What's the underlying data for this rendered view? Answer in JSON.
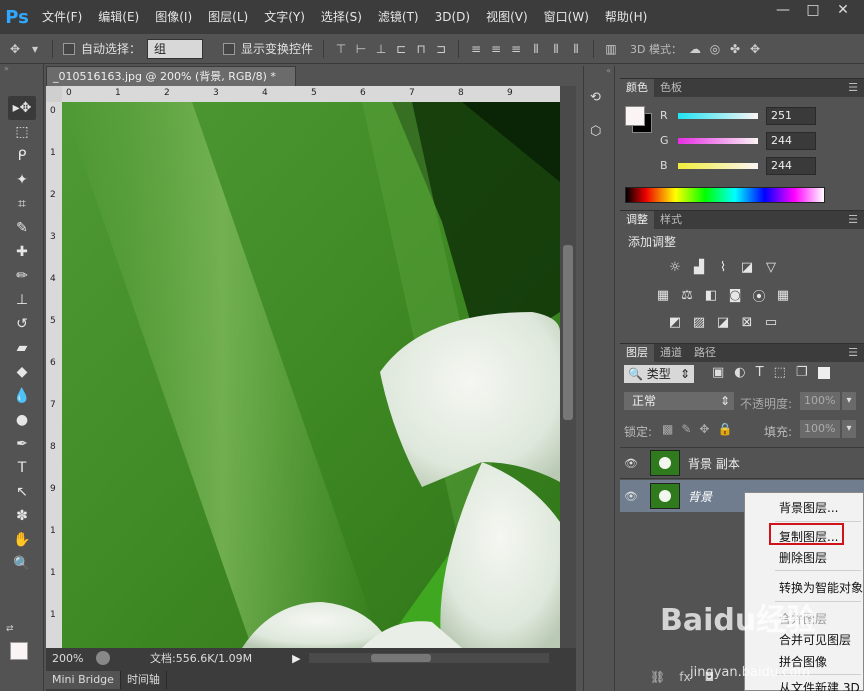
{
  "app": {
    "logo": "Ps"
  },
  "menu": [
    "文件(F)",
    "编辑(E)",
    "图像(I)",
    "图层(L)",
    "文字(Y)",
    "选择(S)",
    "滤镜(T)",
    "3D(D)",
    "视图(V)",
    "窗口(W)",
    "帮助(H)"
  ],
  "window_controls": {
    "minimize": "—",
    "maximize": "□",
    "close": "✕"
  },
  "options": {
    "auto_select_label": "自动选择：",
    "auto_select_value": "组",
    "show_transform_label": "显示变换控件",
    "mode_3d_label": "3D 模式："
  },
  "document": {
    "tab_title": "_010516163.jpg @ 200% (背景, RGB/8) *",
    "close": "×",
    "ruler_top": [
      "0",
      "1",
      "2",
      "3",
      "4",
      "5",
      "6",
      "7",
      "8",
      "9"
    ],
    "ruler_left": [
      "0",
      "1",
      "2",
      "3",
      "4",
      "5",
      "6",
      "7",
      "8",
      "9",
      "1",
      "1",
      "1"
    ],
    "zoom": "200%",
    "doc_info": "文档:556.6K/1.09M"
  },
  "bottom_tabs": [
    "Mini Bridge",
    "时间轴"
  ],
  "color_panel": {
    "tabs": [
      "颜色",
      "色板"
    ],
    "channels": [
      {
        "label": "R",
        "value": "251",
        "color": "#25e8ef"
      },
      {
        "label": "G",
        "value": "244",
        "color": "#e43fe0"
      },
      {
        "label": "B",
        "value": "244",
        "color": "#e9e64a"
      }
    ],
    "foreground": "#fbf4f4",
    "background": "#000000"
  },
  "adjust_panel": {
    "tabs": [
      "调整",
      "样式"
    ],
    "title": "添加调整"
  },
  "layers_panel": {
    "tabs": [
      "图层",
      "通道",
      "路径"
    ],
    "filter_label": "类型",
    "blend_mode": "正常",
    "opacity_label": "不透明度:",
    "opacity_value": "100%",
    "lock_label": "锁定:",
    "fill_label": "填充:",
    "fill_value": "100%",
    "layers": [
      {
        "name": "背景 副本",
        "eye": "👁"
      },
      {
        "name": "背景",
        "eye": "👁"
      }
    ]
  },
  "context_menu": {
    "items": [
      {
        "label": "背景图层...",
        "enabled": true
      },
      {
        "label": "复制图层...",
        "enabled": true
      },
      {
        "label": "删除图层",
        "enabled": true
      },
      {
        "label": "转换为智能对象",
        "enabled": true
      },
      {
        "label": "合并图层",
        "enabled": false
      },
      {
        "label": "合并可见图层",
        "enabled": true
      },
      {
        "label": "拼合图像",
        "enabled": true
      },
      {
        "label": "从文件新建 3D",
        "enabled": true
      }
    ]
  },
  "watermark": {
    "main": "Baidu经验",
    "sub": "jingyan.baidu.com"
  }
}
